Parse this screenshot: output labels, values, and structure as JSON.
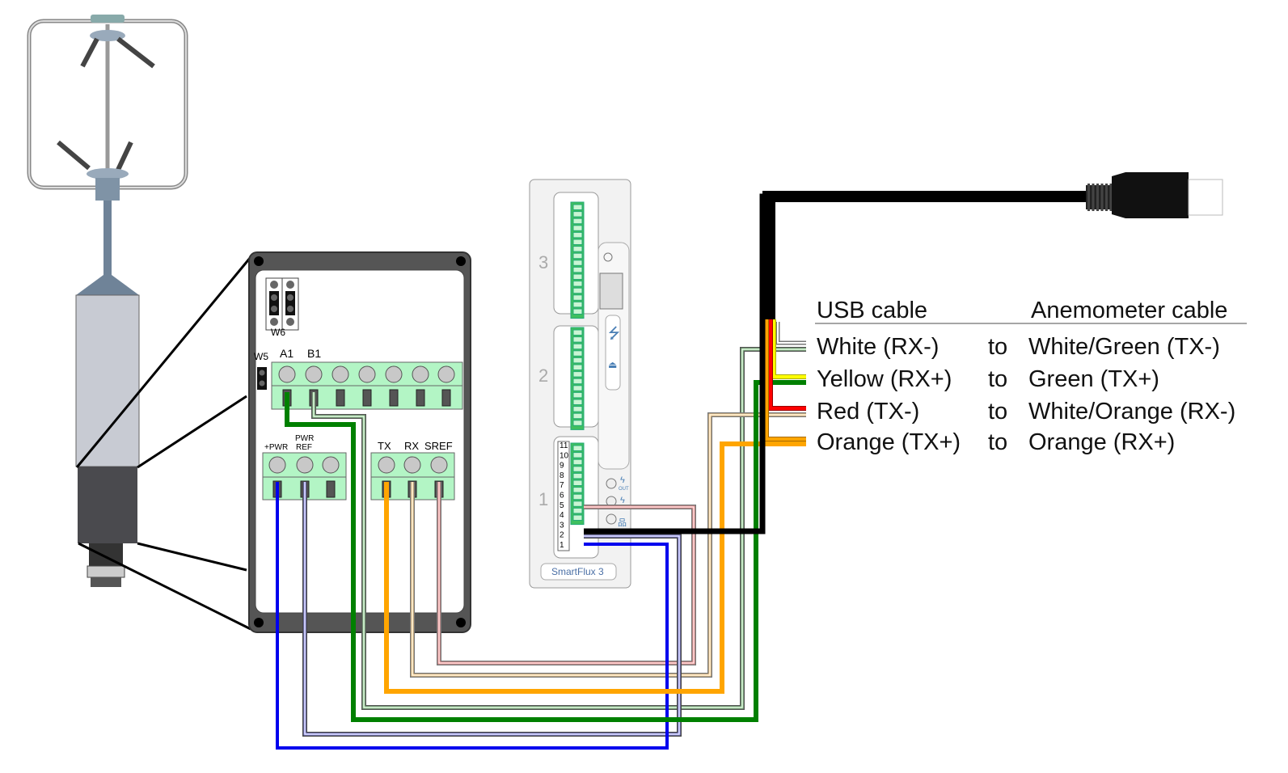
{
  "legend": {
    "usb_header": "USB cable",
    "anemometer_header": "Anemometer cable",
    "rows": [
      {
        "usb": "White (RX-)",
        "to": "to",
        "anemometer": "White/Green (TX-)"
      },
      {
        "usb": "Yellow (RX+)",
        "to": "to",
        "anemometer": "Green (TX+)"
      },
      {
        "usb": "Red (TX-)",
        "to": "to",
        "anemometer": "White/Orange (RX-)"
      },
      {
        "usb": "Orange (TX+)",
        "to": "to",
        "anemometer": "Orange (RX+)"
      }
    ]
  },
  "board": {
    "jumper_w6": "W6",
    "jumper_w5": "W5",
    "a1": "A1",
    "b1": "B1",
    "pwr_plus": "+PWR",
    "pwr_ref_1": "PWR",
    "pwr_ref_2": "REF",
    "tx": "TX",
    "rx": "RX",
    "sref": "SREF"
  },
  "smartflux": {
    "name": "SmartFlux 3",
    "sections": [
      "3",
      "2",
      "1"
    ],
    "pins": [
      "11",
      "10",
      "9",
      "8",
      "7",
      "6",
      "5",
      "4",
      "3",
      "2",
      "1"
    ],
    "port_out": "OUT"
  },
  "colors": {
    "black": "#000000",
    "green": "#008000",
    "blue": "#0000ee",
    "orange": "#ffa500",
    "red": "#ff0000",
    "yellow": "#ffff00",
    "terminal": "#b3f5c5"
  }
}
